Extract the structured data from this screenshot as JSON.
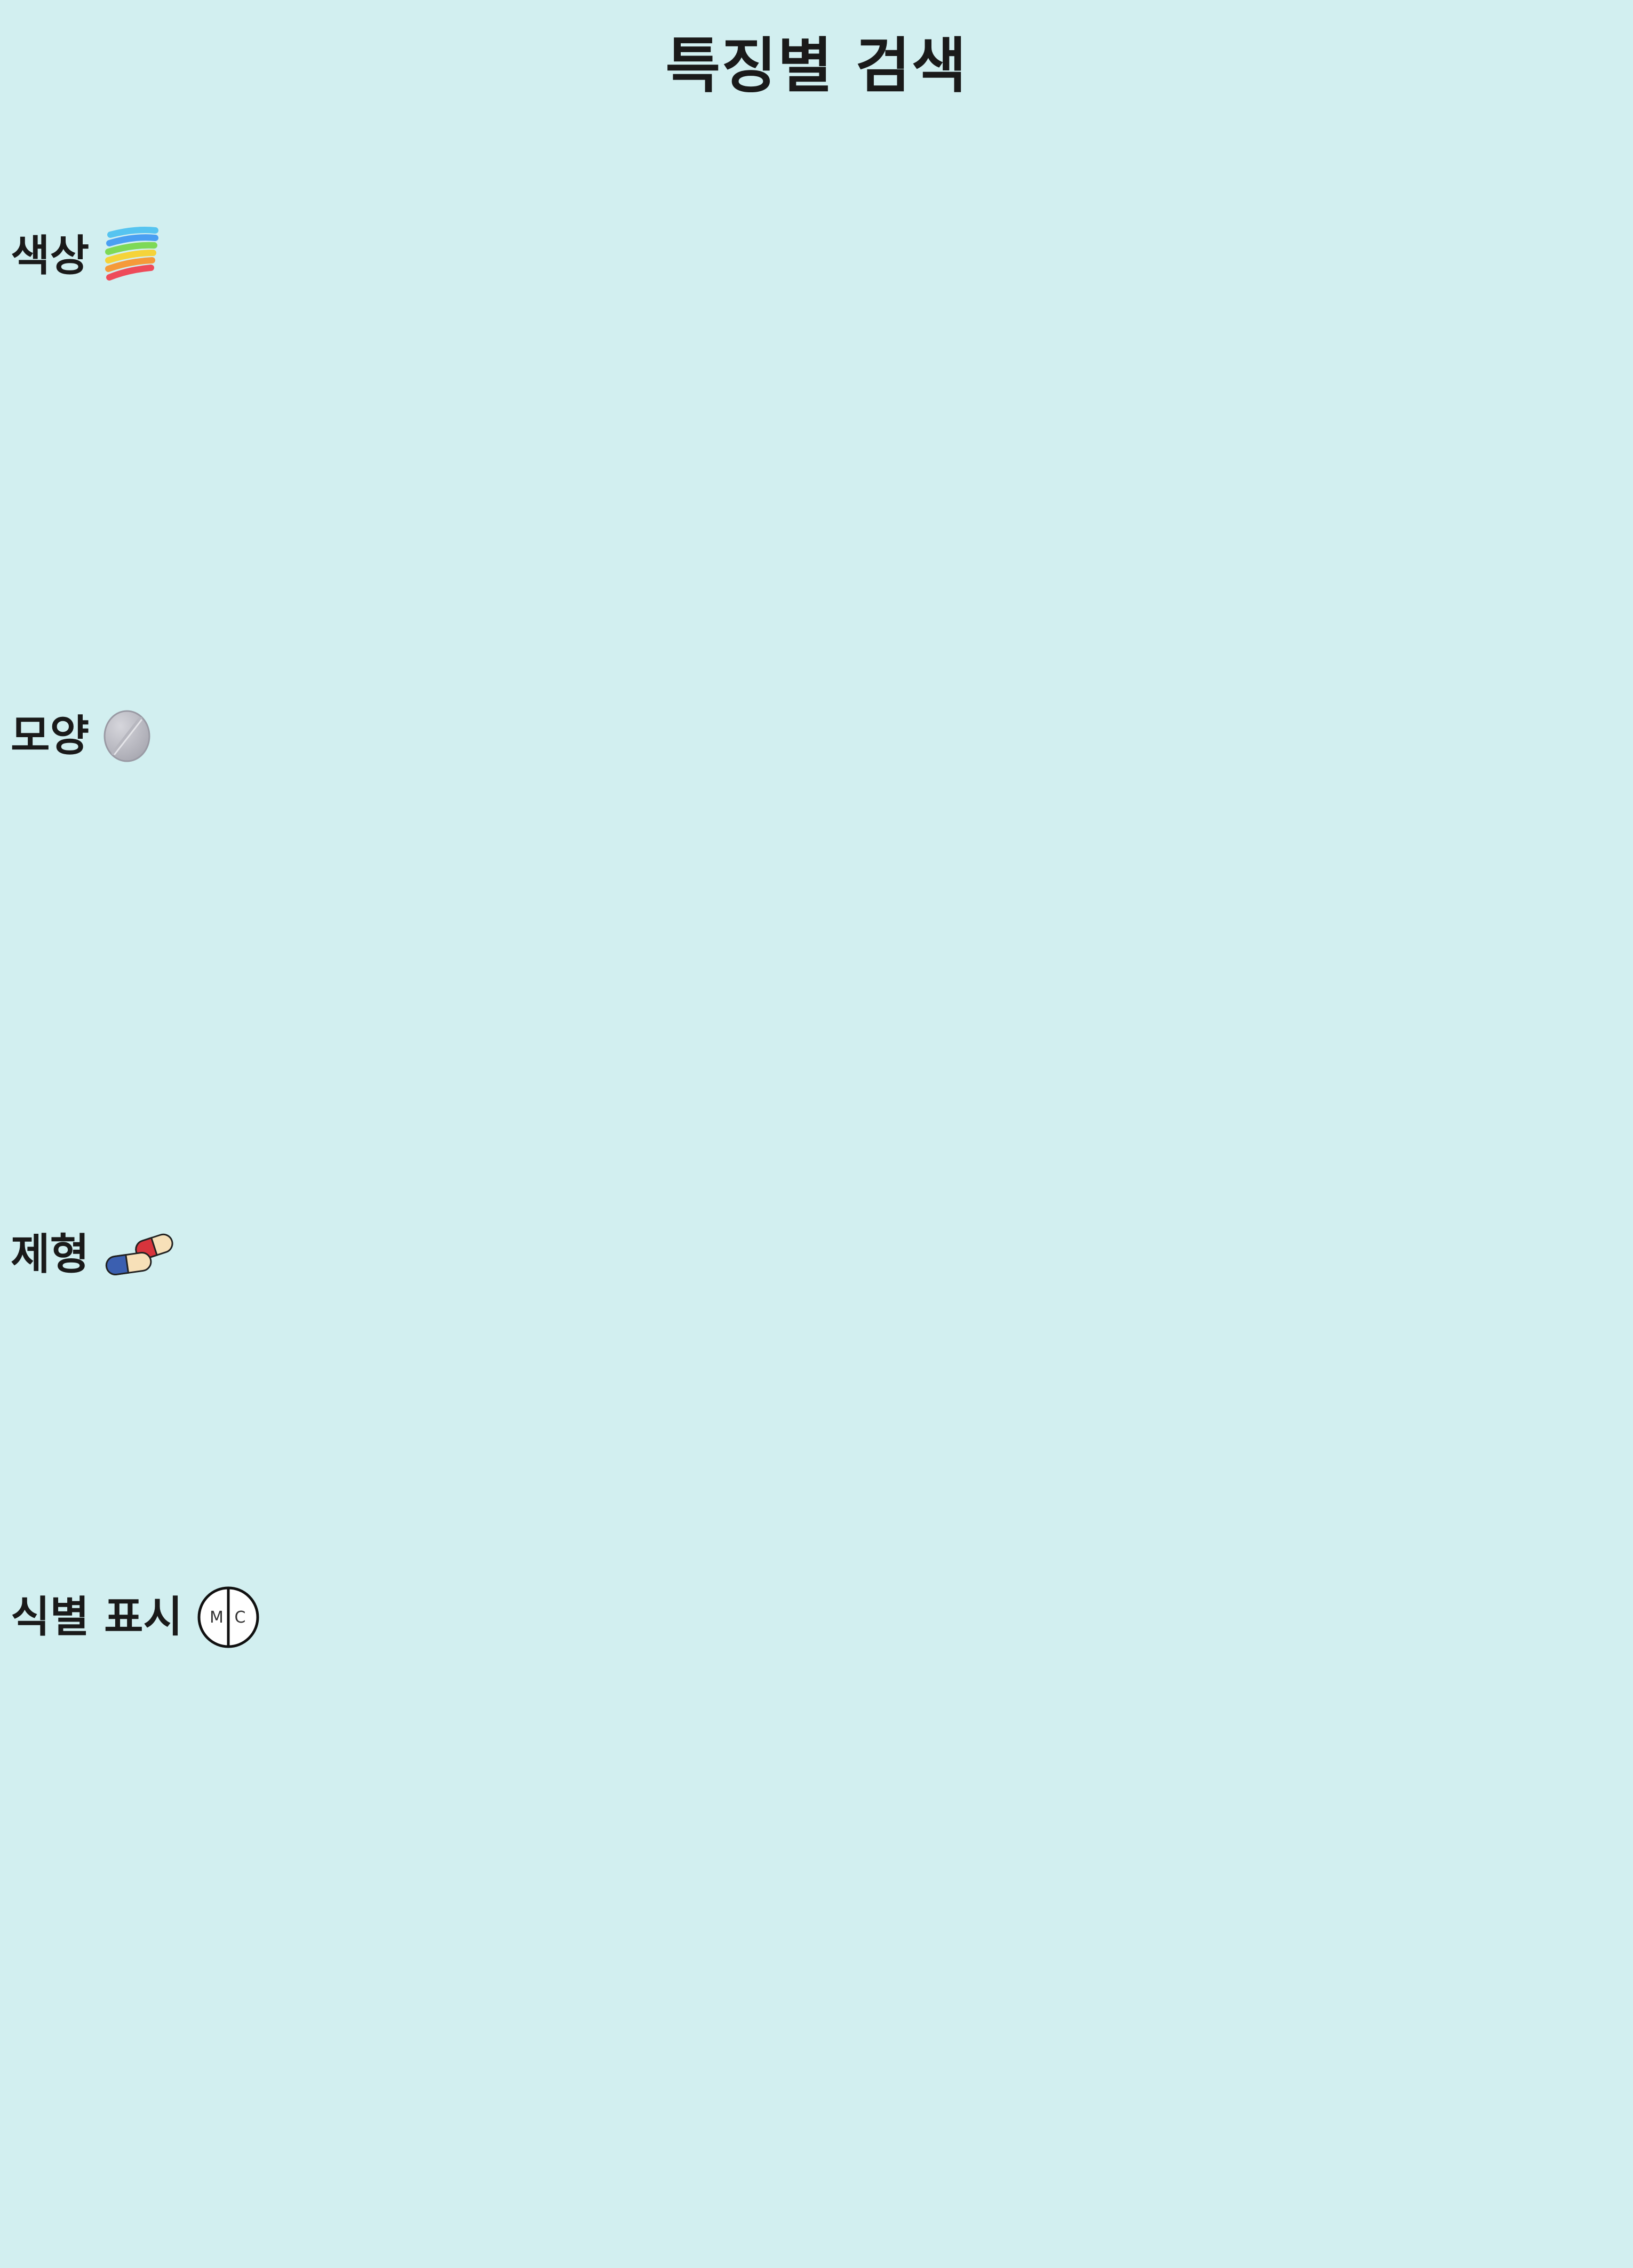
{
  "page": {
    "title": "특징별 검색",
    "background": "#d2eff0"
  },
  "sections": {
    "color": {
      "label": "색상",
      "icon": "rainbow-icon"
    },
    "shape": {
      "label": "모양",
      "icon": "round-tablet-icon"
    },
    "form": {
      "label": "제형",
      "icon": "capsules-icon"
    },
    "mark": {
      "label": "식별 표시",
      "icon": "imprint-mark-icon",
      "icon_text_left": "M",
      "icon_text_right": "C"
    }
  }
}
